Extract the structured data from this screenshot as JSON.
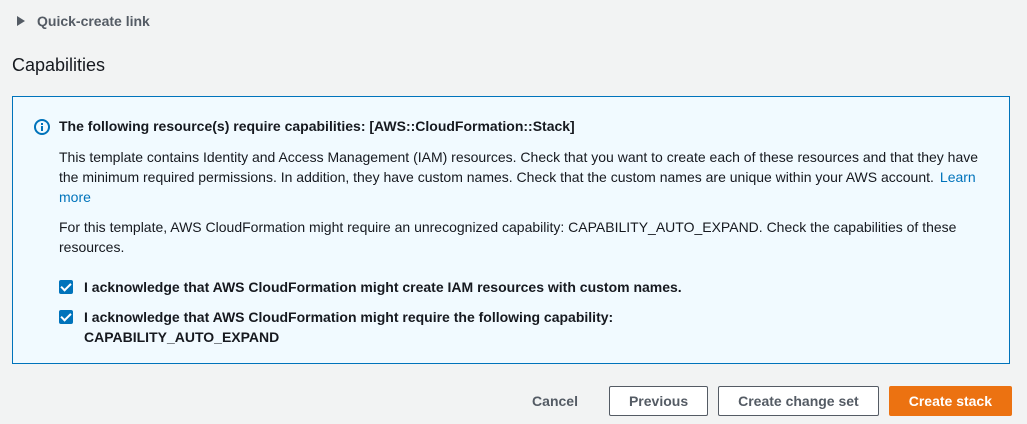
{
  "quick_create": {
    "label": "Quick-create link",
    "icon": "caret-right-icon"
  },
  "capabilities": {
    "title": "Capabilities",
    "info": {
      "icon": "info-icon",
      "heading": "The following resource(s) require capabilities: [AWS::CloudFormation::Stack]",
      "paragraph1": "This template contains Identity and Access Management (IAM) resources. Check that you want to create each of these resources and that they have the minimum required permissions. In addition, they have custom names. Check that the custom names are unique within your AWS account.",
      "learn_more": "Learn more",
      "paragraph2": "For this template, AWS CloudFormation might require an unrecognized capability: CAPABILITY_AUTO_EXPAND. Check the capabilities of these resources."
    },
    "acknowledgements": [
      {
        "text": "I acknowledge that AWS CloudFormation might create IAM resources with custom names.",
        "checked": true
      },
      {
        "text": "I acknowledge that AWS CloudFormation might require the following capability:",
        "capability": "CAPABILITY_AUTO_EXPAND",
        "checked": true
      }
    ]
  },
  "actions": {
    "cancel": "Cancel",
    "previous": "Previous",
    "create_change_set": "Create change set",
    "create_stack": "Create stack"
  },
  "colors": {
    "accent": "#0073bb",
    "primary_button": "#ec7211",
    "info_background": "#f1faff",
    "page_background": "#f2f3f3"
  }
}
